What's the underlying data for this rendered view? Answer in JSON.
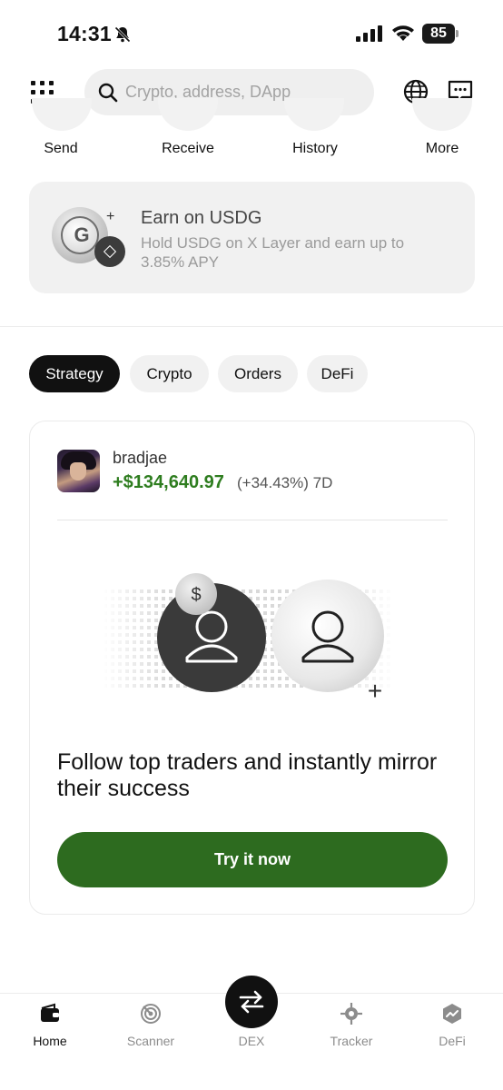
{
  "status_bar": {
    "time": "14:31",
    "battery": "85",
    "battery_level": 0.85
  },
  "header": {
    "search_placeholder": "Crypto, address, DApp"
  },
  "quick_actions": [
    {
      "label": "Send"
    },
    {
      "label": "Receive"
    },
    {
      "label": "History"
    },
    {
      "label": "More"
    }
  ],
  "banner": {
    "plus": "+",
    "title": "Earn on USDG",
    "text": "Hold USDG on X Layer and earn up to 3.85% APY"
  },
  "tabs": [
    {
      "label": "Strategy",
      "active": true
    },
    {
      "label": "Crypto",
      "active": false
    },
    {
      "label": "Orders",
      "active": false
    },
    {
      "label": "DeFi",
      "active": false
    }
  ],
  "card": {
    "trader_name": "bradjae",
    "pnl": "+$134,640.97",
    "change": "(+34.43%) 7D",
    "illustration_dollar": "$",
    "illustration_plus": "+",
    "heading": "Follow top traders and instantly mirror their success",
    "cta_label": "Try it now"
  },
  "bottom_nav": {
    "items": [
      {
        "label": "Home",
        "icon": "wallet-icon"
      },
      {
        "label": "Scanner",
        "icon": "scanner-icon"
      },
      {
        "label": "DEX",
        "icon": "swap-arrows-icon"
      },
      {
        "label": "Tracker",
        "icon": "crosshair-icon"
      },
      {
        "label": "DeFi",
        "icon": "defi-hexagon-icon"
      }
    ]
  },
  "colors": {
    "accent_green": "#2e7d1f",
    "cta_green": "#2d6b1f",
    "dark": "#111111"
  }
}
